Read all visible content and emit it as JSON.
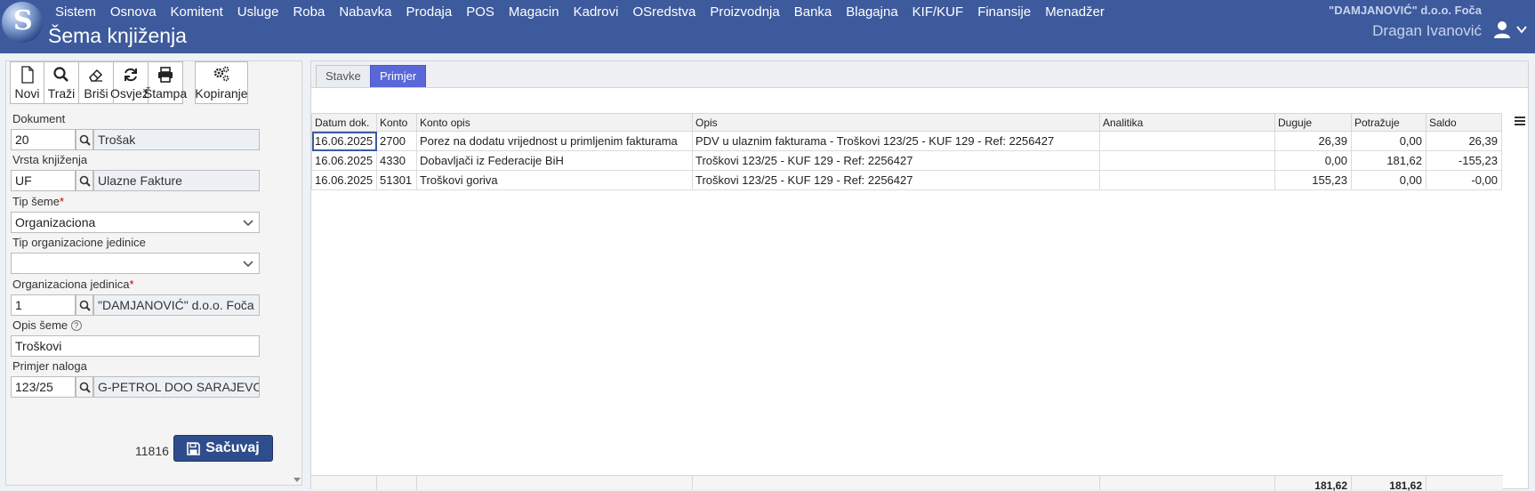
{
  "header": {
    "menu": [
      "Sistem",
      "Osnova",
      "Komitent",
      "Usluge",
      "Roba",
      "Nabavka",
      "Prodaja",
      "POS",
      "Magacin",
      "Kadrovi",
      "OSredstva",
      "Proizvodnja",
      "Banka",
      "Blagajna",
      "KIF/KUF",
      "Finansije",
      "Menadžer"
    ],
    "title": "Šema knjiženja",
    "company": "\"DAMJANOVIĆ\" d.o.o. Foča",
    "user": "Dragan Ivanović"
  },
  "toolbar": {
    "novi": "Novi",
    "trazi": "Traži",
    "brisi": "Briši",
    "osvjezi": "Osvježi",
    "stampa": "Štampa",
    "kopiranje": "Kopiranje"
  },
  "form": {
    "dokument": {
      "label": "Dokument",
      "code": "20",
      "name": "Trošak"
    },
    "vrsta_knjizenja": {
      "label": "Vrsta knjiženja",
      "code": "UF",
      "name": "Ulazne Fakture"
    },
    "tip_seme": {
      "label": "Tip šeme",
      "required_mark": "*",
      "value": "Organizaciona"
    },
    "tip_org_jedinice": {
      "label": "Tip organizacione jedinice",
      "value": ""
    },
    "org_jedinica": {
      "label": "Organizaciona jedinica",
      "required_mark": "*",
      "code": "1",
      "name": "\"DAMJANOVIĆ\" d.o.o. Foča"
    },
    "opis_seme": {
      "label": "Opis šeme",
      "help": "?",
      "value": "Troškovi"
    },
    "primjer_naloga": {
      "label": "Primjer naloga",
      "code": "123/25",
      "name": "G-PETROL DOO SARAJEVO"
    },
    "counter": "11816",
    "save_label": "Sačuvaj"
  },
  "tabs": [
    "Stavke",
    "Primjer"
  ],
  "table": {
    "headers": [
      "Datum dok.",
      "Konto",
      "Konto opis",
      "Opis",
      "Analitika",
      "Duguje",
      "Potražuje",
      "Saldo"
    ],
    "rows": [
      [
        "16.06.2025",
        "2700",
        "Porez na dodatu vrijednost u primljenim fakturama",
        "PDV u ulaznim fakturama - Troškovi 123/25 - KUF 129 - Ref: 2256427",
        "",
        "26,39",
        "0,00",
        "26,39"
      ],
      [
        "16.06.2025",
        "4330",
        "Dobavljači iz Federacije BiH",
        "Troškovi 123/25 - KUF 129 - Ref: 2256427",
        "",
        "0,00",
        "181,62",
        "-155,23"
      ],
      [
        "16.06.2025",
        "51301",
        "Troškovi goriva",
        "Troškovi 123/25 - KUF 129 - Ref: 2256427",
        "",
        "155,23",
        "0,00",
        "-0,00"
      ]
    ],
    "totals": {
      "duguje": "181,62",
      "potrazuje": "181,62"
    }
  }
}
